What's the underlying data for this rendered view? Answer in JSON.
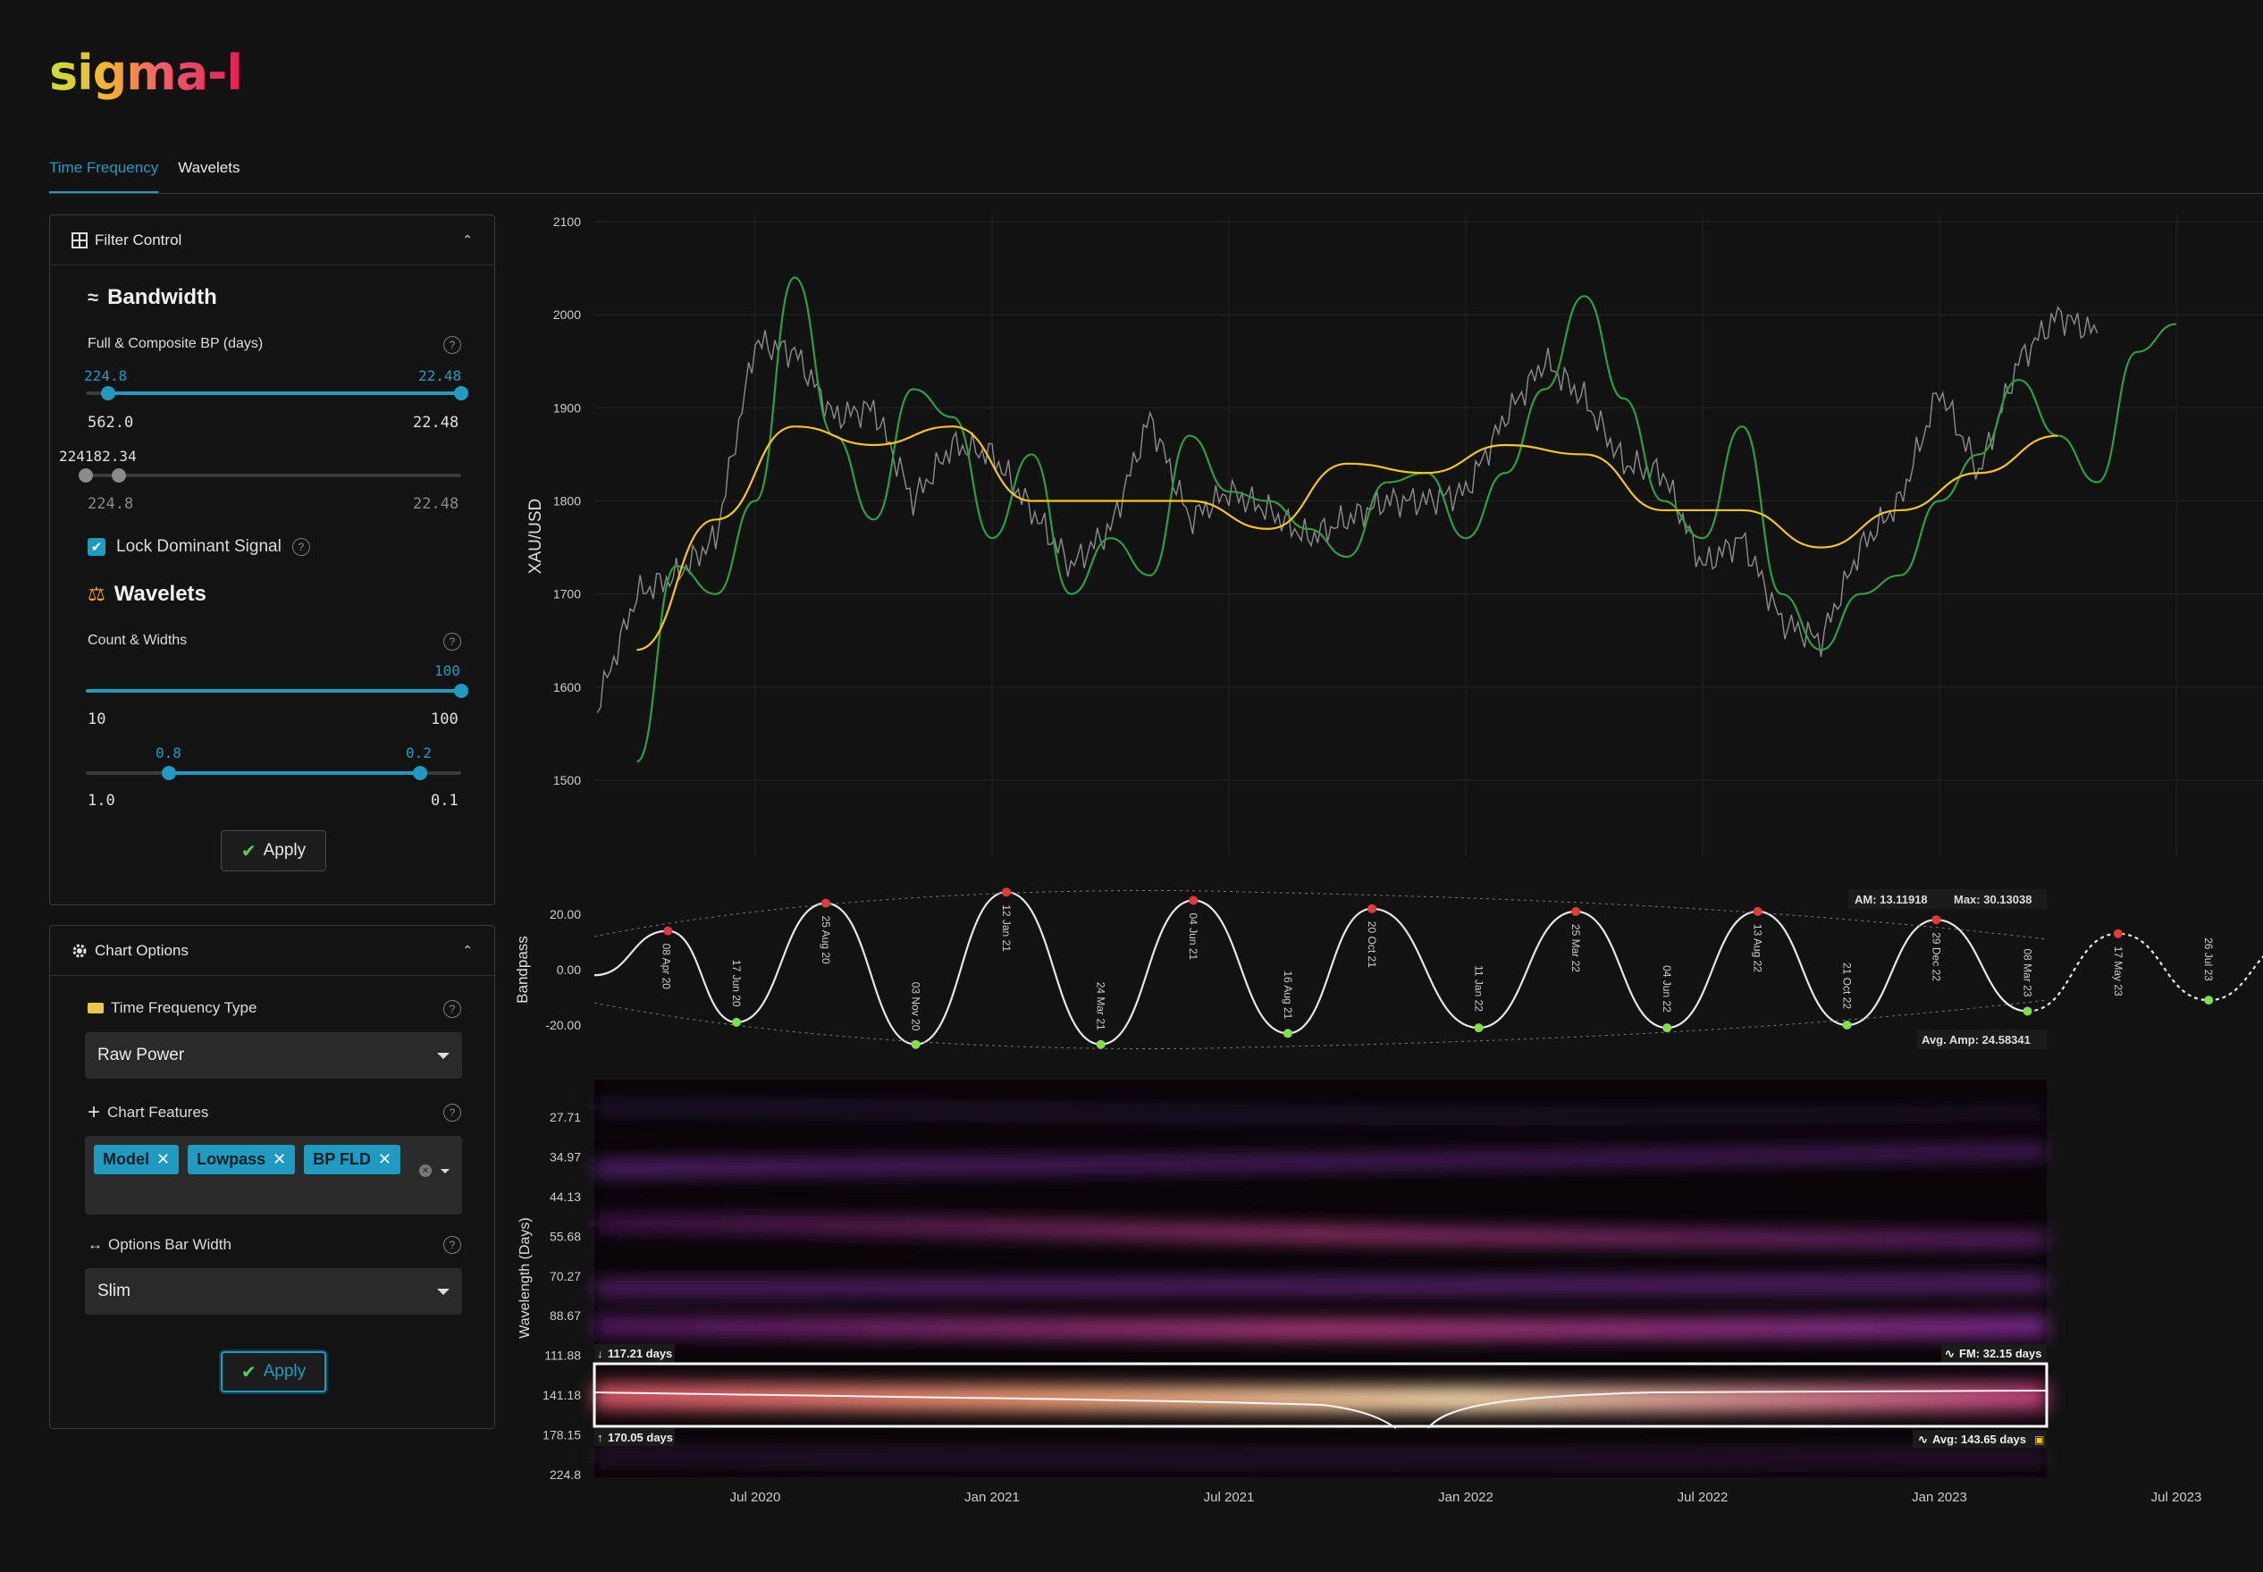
{
  "app": {
    "logo": "sigma-l"
  },
  "tabs": [
    {
      "label": "Time Frequency",
      "active": true
    },
    {
      "label": "Wavelets",
      "active": false
    }
  ],
  "filter_control": {
    "title": "Filter Control",
    "bandwidth": {
      "heading": "Bandwidth",
      "label": "Full & Composite BP (days)",
      "slider1": {
        "low_value": "224.8",
        "high_value": "22.48",
        "min_label": "562.0",
        "max_label": "22.48"
      },
      "slider2": {
        "value_label": "224182.34",
        "min_label": "224.8",
        "max_label": "22.48"
      }
    },
    "lock": {
      "label": "Lock Dominant Signal",
      "checked": true
    },
    "wavelets": {
      "heading": "Wavelets",
      "label": "Count & Widths",
      "count": {
        "value": "100",
        "min_label": "10",
        "max_label": "100"
      },
      "widths": {
        "low_value": "0.8",
        "high_value": "0.2",
        "min_label": "1.0",
        "max_label": "0.1"
      }
    },
    "apply_label": "Apply"
  },
  "chart_options": {
    "title": "Chart Options",
    "tf_type": {
      "label": "Time Frequency Type",
      "value": "Raw Power"
    },
    "features": {
      "label": "Chart Features",
      "chips": [
        "Model",
        "Lowpass",
        "BP FLD"
      ]
    },
    "bar_width": {
      "label": "Options Bar Width",
      "value": "Slim"
    },
    "apply_label": "Apply"
  },
  "colors": {
    "accent": "#1f9bc1",
    "price": "#9a9a9a",
    "fld": "#2e9e46",
    "lowpass": "#f5c518",
    "peak": "#e03a3a",
    "trough": "#7ee04a"
  },
  "chart_data": [
    {
      "type": "line",
      "ylabel": "XAU/USD",
      "ylim": [
        1450,
        2100
      ],
      "yticks": [
        "2100",
        "2000",
        "1900",
        "1800",
        "1700",
        "1600",
        "1500"
      ],
      "x_ticks": [
        "Jul 2020",
        "Jan 2021",
        "Jul 2021",
        "Jan 2022",
        "Jul 2022",
        "Jan 2023",
        "Jul 2023"
      ],
      "series": [
        {
          "key": "price",
          "x": [
            "2020-03",
            "2020-04",
            "2020-05",
            "2020-06",
            "2020-07",
            "2020-08",
            "2020-09",
            "2020-10",
            "2020-11",
            "2020-12",
            "2021-01",
            "2021-02",
            "2021-03",
            "2021-04",
            "2021-05",
            "2021-06",
            "2021-07",
            "2021-08",
            "2021-09",
            "2021-10",
            "2021-11",
            "2021-12",
            "2022-01",
            "2022-02",
            "2022-03",
            "2022-04",
            "2022-05",
            "2022-06",
            "2022-07",
            "2022-08",
            "2022-09",
            "2022-10",
            "2022-11",
            "2022-12",
            "2023-01",
            "2023-02",
            "2023-03",
            "2023-04",
            "2023-05"
          ],
          "values": [
            1580,
            1700,
            1720,
            1760,
            1970,
            1960,
            1890,
            1900,
            1800,
            1860,
            1850,
            1790,
            1730,
            1770,
            1890,
            1780,
            1810,
            1790,
            1760,
            1780,
            1800,
            1800,
            1810,
            1890,
            1950,
            1910,
            1840,
            1830,
            1730,
            1760,
            1670,
            1650,
            1750,
            1800,
            1920,
            1830,
            1950,
            2000,
            1980
          ]
        },
        {
          "key": "fld",
          "x": [
            "2020-04",
            "2020-05",
            "2020-06",
            "2020-07",
            "2020-08",
            "2020-09",
            "2020-10",
            "2020-11",
            "2020-12",
            "2021-01",
            "2021-02",
            "2021-03",
            "2021-04",
            "2021-05",
            "2021-06",
            "2021-07",
            "2021-08",
            "2021-09",
            "2021-10",
            "2021-11",
            "2021-12",
            "2022-01",
            "2022-02",
            "2022-03",
            "2022-04",
            "2022-05",
            "2022-06",
            "2022-07",
            "2022-08",
            "2022-09",
            "2022-10",
            "2022-11",
            "2022-12",
            "2023-01",
            "2023-02",
            "2023-03",
            "2023-04",
            "2023-05",
            "2023-06",
            "2023-07"
          ],
          "values": [
            1520,
            1730,
            1700,
            1800,
            2040,
            1870,
            1780,
            1920,
            1890,
            1760,
            1850,
            1700,
            1760,
            1720,
            1870,
            1810,
            1800,
            1770,
            1740,
            1820,
            1830,
            1760,
            1830,
            1920,
            2020,
            1910,
            1800,
            1760,
            1880,
            1700,
            1640,
            1700,
            1720,
            1800,
            1850,
            1930,
            1870,
            1820,
            1960,
            1990
          ]
        },
        {
          "key": "lowpass",
          "x": [
            "2020-04",
            "2020-06",
            "2020-08",
            "2020-10",
            "2020-12",
            "2021-02",
            "2021-04",
            "2021-06",
            "2021-08",
            "2021-10",
            "2021-12",
            "2022-02",
            "2022-04",
            "2022-06",
            "2022-08",
            "2022-10",
            "2022-12",
            "2023-02",
            "2023-04"
          ],
          "values": [
            1640,
            1780,
            1880,
            1860,
            1880,
            1800,
            1800,
            1800,
            1770,
            1840,
            1830,
            1860,
            1850,
            1790,
            1790,
            1750,
            1790,
            1830,
            1870
          ]
        }
      ]
    },
    {
      "type": "line",
      "ylabel": "Bandpass",
      "ylim": [
        -30,
        30
      ],
      "yticks": [
        "20.00",
        "0.00",
        "-20.00"
      ],
      "annotations": {
        "am": "AM: 13.11918",
        "max": "Max: 30.13038",
        "avg_amp": "Avg. Amp: 24.58341"
      },
      "peak_labels": [
        "25 Aug 20",
        "12 Jan 21",
        "04 Jun 21",
        "20 Oct 21",
        "25 Mar 22",
        "13 Aug 22",
        "29 Dec 22",
        "17 May 23"
      ],
      "trough_labels": [
        "08 Apr 20",
        "17 Jun 20",
        "03 Nov 20",
        "24 Mar 21",
        "16 Aug 21",
        "11 Jan 22",
        "04 Jun 22",
        "21 Oct 22",
        "08 Mar 23",
        "26 Jul 23"
      ]
    },
    {
      "type": "heatmap",
      "ylabel": "Wavelength (Days)",
      "yticks": [
        "27.71",
        "34.97",
        "44.13",
        "55.68",
        "70.27",
        "88.67",
        "111.88",
        "141.18",
        "178.15",
        "224.8"
      ],
      "band_labels": {
        "top_left": "117.21 days",
        "bottom_left": "170.05 days",
        "top_right": "FM: 32.15 days",
        "bottom_right": "Avg: 143.65 days"
      }
    }
  ]
}
